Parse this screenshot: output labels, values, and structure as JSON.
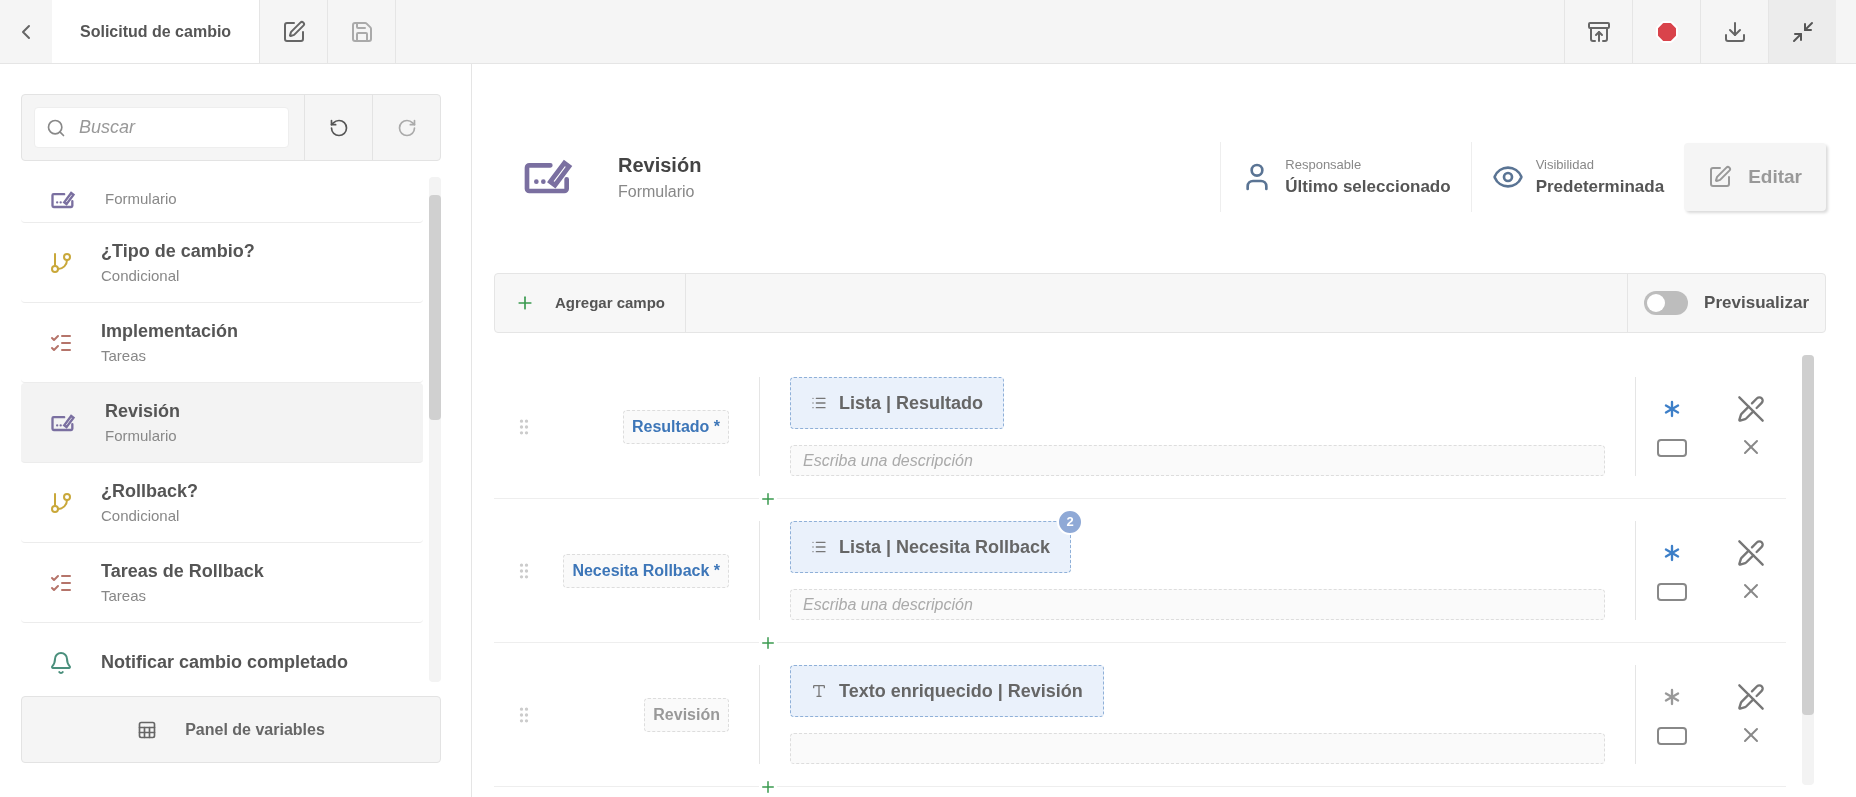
{
  "top_bar": {
    "tabs": [
      {
        "label": "Solicitud de cambio",
        "selected": true
      }
    ],
    "save_disabled": true
  },
  "sidebar": {
    "search": {
      "placeholder": "Buscar"
    },
    "redo_disabled": true,
    "items": [
      {
        "kind": "form",
        "subtitle": "Formulario",
        "selected": false
      },
      {
        "kind": "conditional",
        "title": "¿Tipo de cambio?",
        "subtitle": "Condicional",
        "selected": false
      },
      {
        "kind": "tasks",
        "title": "Implementación",
        "subtitle": "Tareas",
        "selected": false
      },
      {
        "kind": "form",
        "title": "Revisión",
        "subtitle": "Formulario",
        "selected": true
      },
      {
        "kind": "conditional",
        "title": "¿Rollback?",
        "subtitle": "Condicional",
        "selected": false
      },
      {
        "kind": "tasks",
        "title": "Tareas de Rollback",
        "subtitle": "Tareas",
        "selected": false
      },
      {
        "kind": "notify",
        "title": "Notificar cambio completado",
        "selected": false
      }
    ],
    "footer_button": "Panel de variables"
  },
  "header": {
    "title": "Revisión",
    "subtitle": "Formulario",
    "responsible": {
      "label": "Responsable",
      "value": "Último seleccionado"
    },
    "visibility": {
      "label": "Visibilidad",
      "value": "Predeterminada"
    },
    "edit_button": "Editar"
  },
  "toolbar": {
    "add_button": "Agregar campo",
    "preview": {
      "label": "Previsualizar",
      "on": false
    }
  },
  "fields": [
    {
      "label": "Resultado *",
      "required": true,
      "kind": "list",
      "chip": "Lista | Resultado",
      "description_placeholder": "Escriba una descripción"
    },
    {
      "label": "Necesita Rollback *",
      "required": true,
      "kind": "list",
      "chip": "Lista | Necesita Rollback",
      "badge": "2",
      "description_placeholder": "Escriba una descripción"
    },
    {
      "label": "Revisión",
      "required": false,
      "kind": "rich_text",
      "chip": "Texto enriquecido | Revisión"
    }
  ]
}
